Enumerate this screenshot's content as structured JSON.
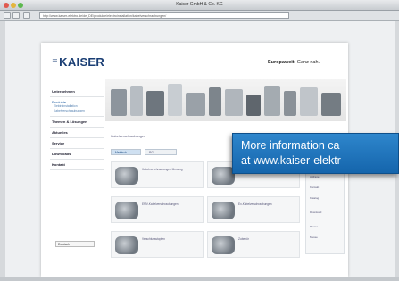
{
  "window": {
    "title": "Kaiser GmbH & Co. KG"
  },
  "browser": {
    "url": "http://www.kaiser-elektro.de/de_DE/produkte/elektroinstallation/kabelverschraubungen/"
  },
  "header": {
    "logo_mark": "⁼",
    "logo": "KAISER",
    "slogan_bold": "Europaweit.",
    "slogan_rest": " Ganz nah."
  },
  "leftnav": {
    "items": [
      {
        "label": "Unternehmen",
        "sub": []
      },
      {
        "label": "Produkte",
        "sub": [
          "Elektroinstallation",
          "Kabelverschraubungen"
        ]
      },
      {
        "label": "Themen & Lösungen",
        "sub": []
      },
      {
        "label": "Aktuelles",
        "sub": []
      },
      {
        "label": "Service",
        "sub": []
      },
      {
        "label": "Downloads",
        "sub": []
      },
      {
        "label": "Kontakt",
        "sub": []
      }
    ],
    "language": "Deutsch"
  },
  "content": {
    "breadcrumb": "Kabelverschraubungen",
    "tabs": [
      "Metrisch",
      "PG"
    ],
    "cards": [
      "Kabelverschraubungen Messing",
      "Kabelverschraubungen Edelstahl",
      "EMV-Kabelverschraubungen",
      "Ex-Kabelverschraubungen",
      "Verschlussstopfen",
      "Zubehör"
    ]
  },
  "sidebar": {
    "lines": [
      "Anfrage",
      "Kontakt",
      "Katalog",
      "Download",
      "Presse",
      "Messe"
    ]
  },
  "callout": {
    "line1": "More information ca",
    "line2": "at www.kaiser-elektr"
  }
}
